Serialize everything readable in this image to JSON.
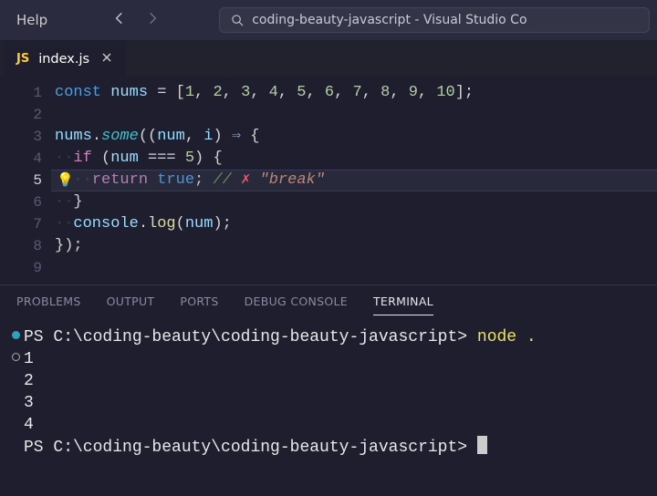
{
  "titlebar": {
    "help": "Help",
    "search_label": "coding-beauty-javascript - Visual Studio Co"
  },
  "tab": {
    "lang": "JS",
    "filename": "index.js"
  },
  "editor": {
    "lines": [
      "1",
      "2",
      "3",
      "4",
      "5",
      "6",
      "7",
      "8",
      "9"
    ],
    "current_line": 5,
    "l1": {
      "const": "const",
      "nums": "nums",
      "eq": "=",
      "vals": [
        "1",
        "2",
        "3",
        "4",
        "5",
        "6",
        "7",
        "8",
        "9",
        "10"
      ]
    },
    "l3": {
      "nums": "nums",
      "some": "some",
      "num": "num",
      "i": "i",
      "arrow": "⇒"
    },
    "l4": {
      "if": "if",
      "num": "num",
      "eqeq": "===",
      "five": "5"
    },
    "l5": {
      "ret": "return",
      "true": "true",
      "cm": "//",
      "x": "✗",
      "str": "\"break\""
    },
    "l7": {
      "console": "console",
      "log": "log",
      "num": "num"
    }
  },
  "panel": {
    "tabs": [
      "PROBLEMS",
      "OUTPUT",
      "PORTS",
      "DEBUG CONSOLE",
      "TERMINAL"
    ],
    "active": "TERMINAL"
  },
  "terminal": {
    "prompt": "PS C:\\coding-beauty\\coding-beauty-javascript>",
    "cmd": "node .",
    "output": [
      "1",
      "2",
      "3",
      "4"
    ]
  }
}
